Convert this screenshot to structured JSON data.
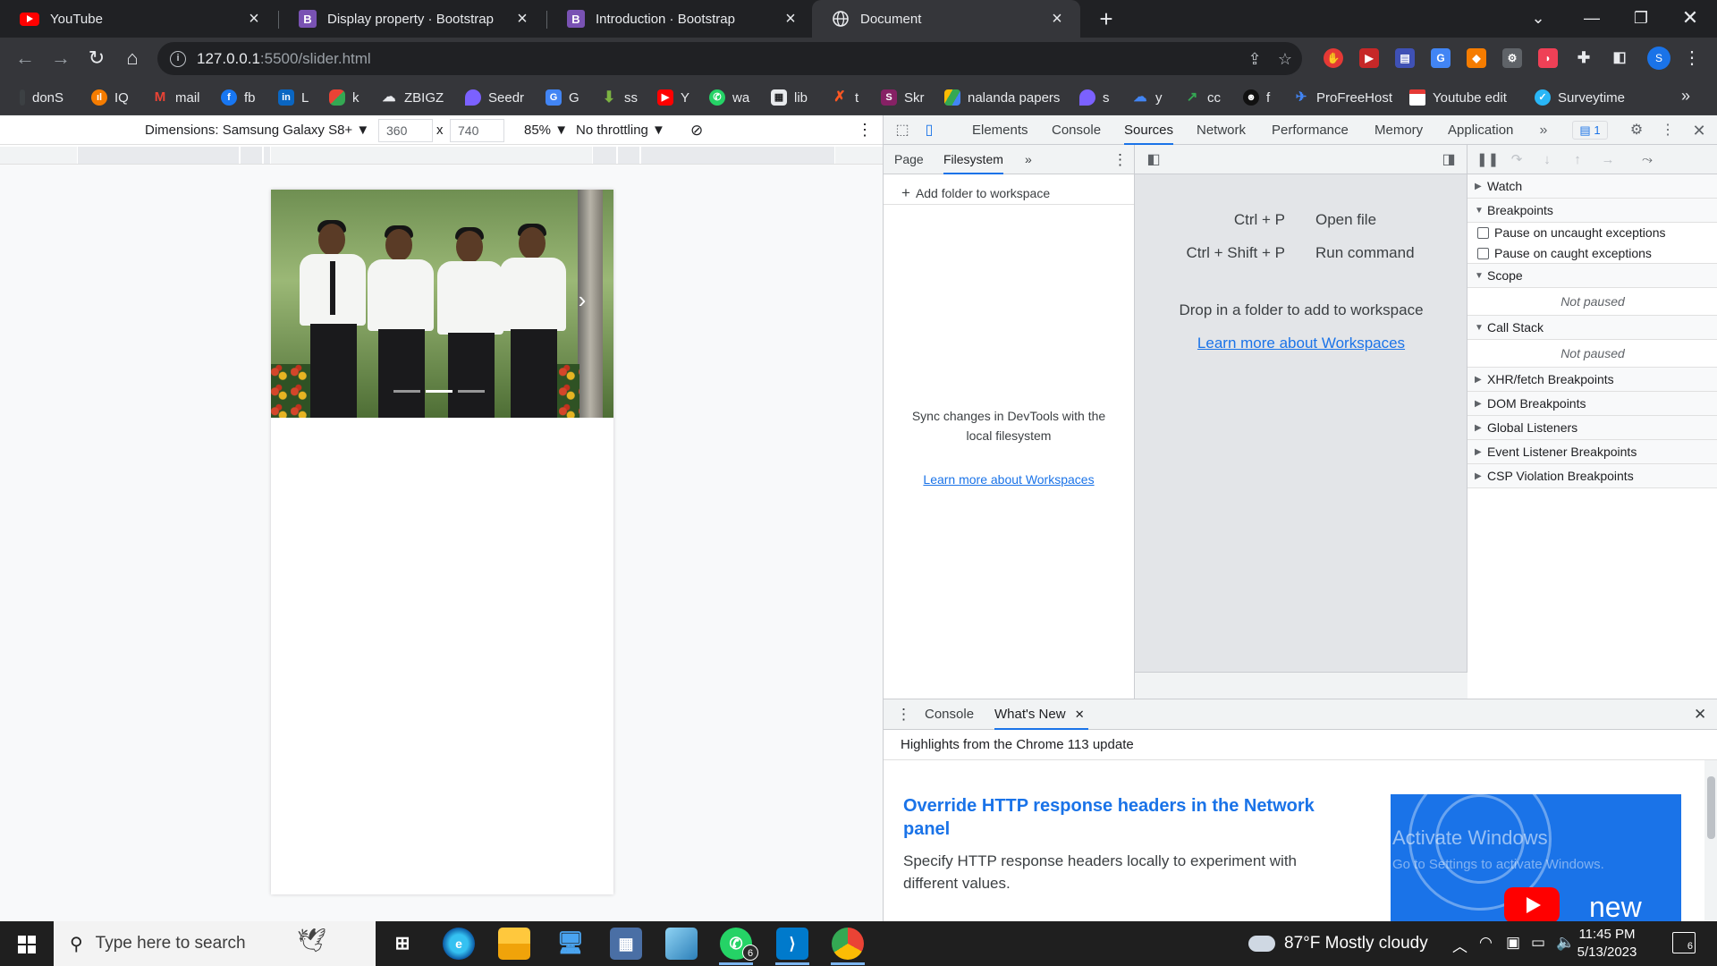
{
  "browser": {
    "tabs": [
      {
        "title": "YouTube",
        "icon": "youtube-icon",
        "favicon_color": "#ff0000",
        "active": false
      },
      {
        "title": "Display property · Bootstrap",
        "icon": "bootstrap-icon",
        "favicon_glyph": "B",
        "favicon_color": "#7952b3",
        "active": false
      },
      {
        "title": "Introduction · Bootstrap",
        "icon": "bootstrap-icon",
        "favicon_glyph": "B",
        "favicon_color": "#7952b3",
        "active": false
      },
      {
        "title": "Document",
        "icon": "globe-icon",
        "active": true
      }
    ],
    "url_host": "127.0.0.1",
    "url_path": ":5500/slider.html",
    "profile_initial": "S",
    "bookmarks": [
      "donS",
      "IQ",
      "mail",
      "fb",
      "L",
      "k",
      "ZBIGZ",
      "Seedr",
      "G",
      "ss",
      "Y",
      "wa",
      "lib",
      "t",
      "Skr",
      "nalanda papers",
      "s",
      "y",
      "cc",
      "f",
      "ProFreeHost",
      "Youtube edit",
      "Surveytime"
    ]
  },
  "device_toolbar": {
    "dimensions_label": "Dimensions: Samsung Galaxy S8+",
    "width": "360",
    "times": "x",
    "height": "740",
    "zoom": "85%",
    "throttling": "No throttling"
  },
  "devtools": {
    "tabs": [
      "Elements",
      "Console",
      "Sources",
      "Network",
      "Performance",
      "Memory",
      "Application"
    ],
    "active_tab": "Sources",
    "issues_count": "1",
    "navigator_tabs": [
      "Page",
      "Filesystem"
    ],
    "add_folder": "Add folder to workspace",
    "sync_text": "Sync changes in DevTools with the local filesystem",
    "learn_more": "Learn more about Workspaces",
    "shortcuts": [
      {
        "keys": "Ctrl + P",
        "action": "Open file"
      },
      {
        "keys": "Ctrl + Shift + P",
        "action": "Run command"
      }
    ],
    "drop_text": "Drop in a folder to add to workspace",
    "editor_learn_more": "Learn more about Workspaces",
    "debugger": {
      "watch": "Watch",
      "breakpoints": "Breakpoints",
      "pause_uncaught": "Pause on uncaught exceptions",
      "pause_caught": "Pause on caught exceptions",
      "scope": "Scope",
      "call_stack": "Call Stack",
      "not_paused": "Not paused",
      "collapsed_panes": [
        "XHR/fetch Breakpoints",
        "DOM Breakpoints",
        "Global Listeners",
        "Event Listener Breakpoints",
        "CSP Violation Breakpoints"
      ]
    },
    "drawer": {
      "tabs": [
        "Console",
        "What's New"
      ],
      "highlight": "Highlights from the Chrome 113 update",
      "title": "Override HTTP response headers in the Network panel",
      "description": "Specify HTTP response headers locally to experiment with different values.",
      "watermark_line1": "Activate Windows",
      "watermark_line2": "Go to Settings to activate Windows.",
      "thumb_word": "new"
    }
  },
  "taskbar": {
    "search_placeholder": "Type here to search",
    "whatsapp_badge": "6",
    "weather": "87°F  Mostly cloudy",
    "time": "11:45 PM",
    "date": "5/13/2023",
    "notifications": "6"
  },
  "colors": {
    "accent": "#1a73e8",
    "tab_strip": "#202124",
    "toolbar": "#35363a"
  }
}
